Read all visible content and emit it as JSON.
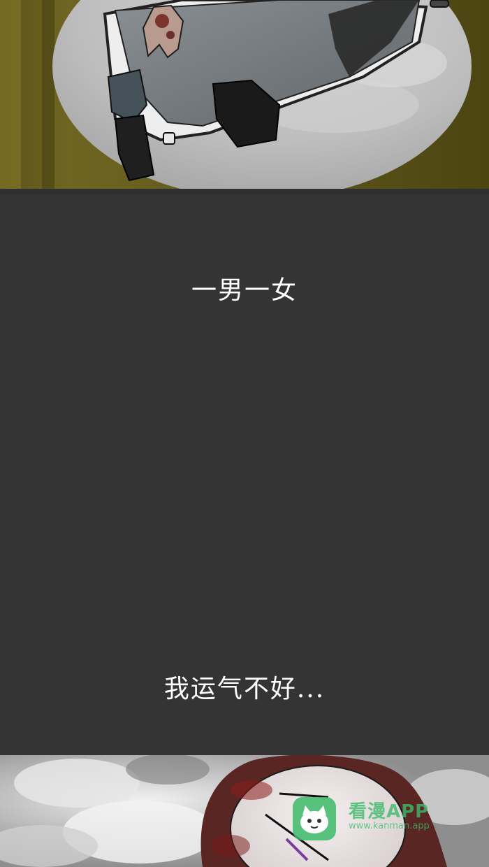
{
  "captions": {
    "line1": "一男一女",
    "line2": "我运气不好..."
  },
  "watermark": {
    "brand": "看漫APP",
    "url": "www.kanman.app",
    "icon": "cat-face-icon",
    "color": "#3dbb6a"
  },
  "colors": {
    "background": "#343434",
    "text": "#ffffff",
    "wall_yellow": "#6f6522",
    "sky_gray": "#c9c9c9"
  }
}
